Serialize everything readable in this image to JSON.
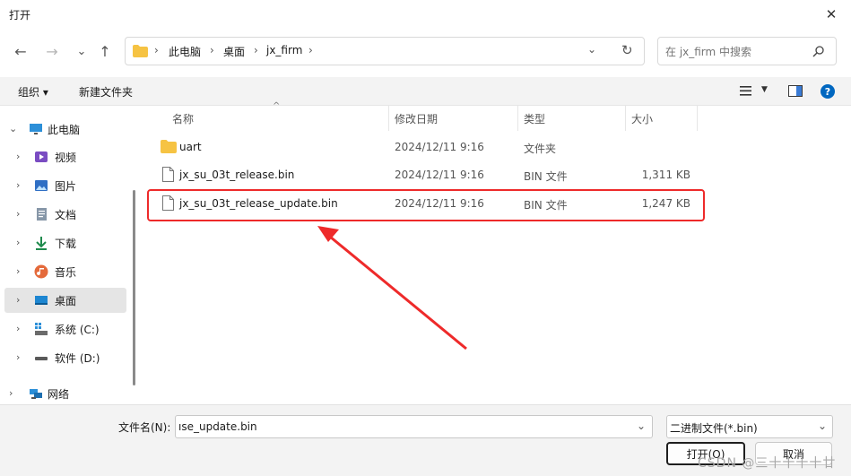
{
  "window": {
    "title": "打开",
    "close_glyph": "✕"
  },
  "nav": {
    "back": "←",
    "forward": "→",
    "recent": "⌄",
    "up": "↑"
  },
  "address": {
    "crumbs": [
      "此电脑",
      "桌面",
      "jx_firm"
    ],
    "separator": "›",
    "dropdown": "⌄",
    "refresh": "↻"
  },
  "search": {
    "placeholder": "在 jx_firm 中搜索"
  },
  "toolbar": {
    "organize": "组织 ▾",
    "new_folder": "新建文件夹",
    "help": "?"
  },
  "sidebar": {
    "items": [
      {
        "label": "此电脑",
        "icon": "monitor-icon",
        "chev": "⌄"
      },
      {
        "label": "视频",
        "icon": "video-icon",
        "chev": "›"
      },
      {
        "label": "图片",
        "icon": "image-icon",
        "chev": "›"
      },
      {
        "label": "文档",
        "icon": "document-icon",
        "chev": "›"
      },
      {
        "label": "下载",
        "icon": "download-icon",
        "chev": "›"
      },
      {
        "label": "音乐",
        "icon": "music-icon",
        "chev": "›"
      },
      {
        "label": "桌面",
        "icon": "desktop-icon",
        "chev": "›"
      },
      {
        "label": "系统 (C:)",
        "icon": "system-drive-icon",
        "chev": "›"
      },
      {
        "label": "软件 (D:)",
        "icon": "drive-icon",
        "chev": "›"
      },
      {
        "label": "网络",
        "icon": "network-icon",
        "chev": "›"
      }
    ],
    "selected_index": 6
  },
  "columns": {
    "name": "名称",
    "modified": "修改日期",
    "type": "类型",
    "size": "大小",
    "sort_glyph": "^"
  },
  "files": [
    {
      "name": "uart",
      "modified": "2024/12/11 9:16",
      "type": "文件夹",
      "size": "",
      "icon": "folder-icon"
    },
    {
      "name": "jx_su_03t_release.bin",
      "modified": "2024/12/11 9:16",
      "type": "BIN 文件",
      "size": "1,311 KB",
      "icon": "file-icon"
    },
    {
      "name": "jx_su_03t_release_update.bin",
      "modified": "2024/12/11 9:16",
      "type": "BIN 文件",
      "size": "1,247 KB",
      "icon": "file-icon"
    }
  ],
  "footer": {
    "filename_label": "文件名(N):",
    "filename_value": "ıse_update.bin",
    "filetype": "二进制文件(*.bin)",
    "open_button": "打开(O)",
    "cancel_button": "取消",
    "watermark": "CSDN @三十十十十廿"
  },
  "colors": {
    "highlight": "#ee2a2a",
    "selected_bg": "#e5e5e5",
    "folder": "#f6c343",
    "accent": "#0067c0"
  }
}
